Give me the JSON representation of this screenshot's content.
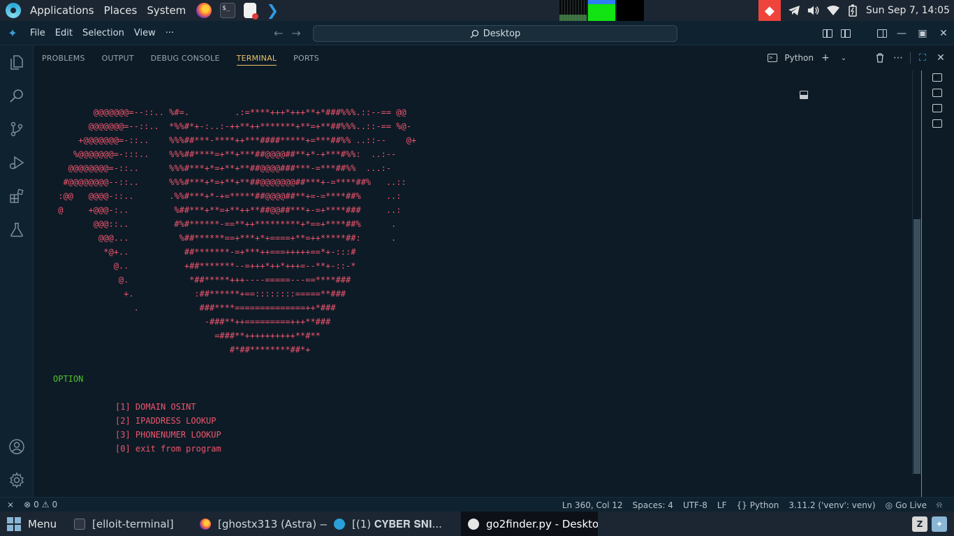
{
  "system_panel": {
    "menus": [
      "Applications",
      "Places",
      "System"
    ],
    "launchers": [
      "firefox-icon",
      "terminal-icon",
      "text-editor-icon",
      "vscode-icon"
    ],
    "clock": "Sun Sep 7, 14:05"
  },
  "titlebar": {
    "menu": [
      "File",
      "Edit",
      "Selection",
      "View",
      "···"
    ],
    "search": "Desktop"
  },
  "panel": {
    "tabs": [
      "PROBLEMS",
      "OUTPUT",
      "DEBUG CONSOLE",
      "TERMINAL",
      "PORTS"
    ],
    "active_tab": "TERMINAL",
    "profile_label": "Python"
  },
  "terminal": {
    "art": [
      "        @@@@@@@=--::.. %#=.         .:=****+++*+++**+*###%%%.::--== @@",
      "       @@@@@@@=--::..  *%%#*+-:..:-++**++*******+**=+**##%%%..::-== %@-",
      "     +@@@@@@@=-::..    %%%##***-****++***####*****+=***##%% ..::--    @+",
      "    %@@@@@@@=-:::..    %%%##****=+**+***##@@@@##**+*-+***#%%:  ..:--",
      "   @@@@@@@@=-::..      %%%#***+*=+**+**##@@@@###***-=***##%%  ...:-",
      "  #@@@@@@@@--::..      %%%#***+*=+**+**##@@@@@@@##***+-=****##%   ..::",
      " :@@   @@@@-::..       .%%#***+*-+=*****##@@@@##**+=-=****##%     ..:",
      " @     +@@@-:..         %##***+**=+**++**##@@##***+-=+****###     ..:",
      "        @@@::..         #%#******-==**++*********+*==+****##%      .",
      "         @@@...          %##******==+***+*+====+**=++*****##:      .",
      "          *@+..           ##*******-=+***++===+++++==*+-:::#",
      "            @..           +##*******--=+++*++*+++=--**+-::-*",
      "             @.            *##*****+++----=====---==****###",
      "              +.            :##******+==::::::::=====**###",
      "                .            ###****==============++*###",
      "                              -###**++=========+++**###",
      "                                =###**++++++++++**#**",
      "                                   #*##********##*+"
    ],
    "option_title": "OPTION",
    "options": [
      "[1] DOMAIN OSINT",
      "[2] IPADDRESS LOOKUP",
      "[3] PHONENUMER LOOKUP",
      "[0] exit from program"
    ]
  },
  "statusbar": {
    "errors": "0",
    "warnings": "0",
    "position": "Ln 360, Col 12",
    "spaces": "Spaces: 4",
    "encoding": "UTF-8",
    "eol": "LF",
    "language": "Python",
    "interpreter": "3.11.2 ('venv': venv)",
    "golive": "Go Live"
  },
  "taskbar": {
    "menu_label": "Menu",
    "tasks": [
      {
        "label": "[elloit-terminal]",
        "icon": "terminal-icon"
      },
      {
        "label": "[ghostx313 (Astra) — ...",
        "icon": "firefox-icon"
      },
      {
        "label": "[(1) 𝐂𝐘𝐁𝐄𝐑 𝐒𝐍𝐈...",
        "icon": "telegram-icon"
      },
      {
        "label": "go2finder.py - Deskto...",
        "icon": "vscode-icon"
      }
    ]
  },
  "colors": {
    "accent": "#e8c468",
    "terminal_red": "#f0556e",
    "terminal_green": "#52c22a",
    "panel_bg": "#0d1b26"
  }
}
